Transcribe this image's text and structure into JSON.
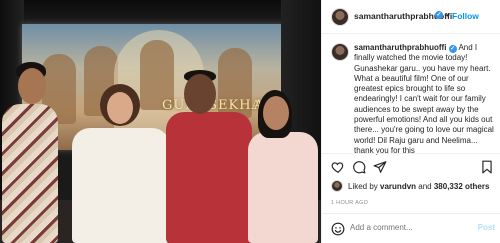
{
  "photo": {
    "screen_title": "GUNASEKHAR",
    "screen_title_2": "AR"
  },
  "header": {
    "username": "samantharuthprabhuoffi",
    "verified_glyph": "✓",
    "separator": "•",
    "follow_label": "Follow"
  },
  "caption": {
    "username": "samantharuthprabhuoffi",
    "text": "And I finally watched the movie today! Gunashekar garu.. you have my heart. What a beautiful film! One of our greatest epics brought to life so endearingly! I can't wait for our family audiences to be swept away by the powerful emotions! And all you kids out there... you're going to love our magical world! Dil Raju garu and Neelima... thank you for this"
  },
  "actions": {
    "icons": [
      "heart-icon",
      "comment-icon",
      "share-icon",
      "bookmark-icon"
    ]
  },
  "likes": {
    "prefix": "Liked by ",
    "user": "varundvn",
    "middle": " and ",
    "count": "380,332 others"
  },
  "timestamp": "1 HOUR AGO",
  "comment": {
    "placeholder": "Add a comment...",
    "post_label": "Post"
  },
  "colors": {
    "accent": "#0095f6",
    "verified": "#3897f0",
    "muted": "#8e8e8e",
    "post_disabled": "#b2dffc"
  }
}
